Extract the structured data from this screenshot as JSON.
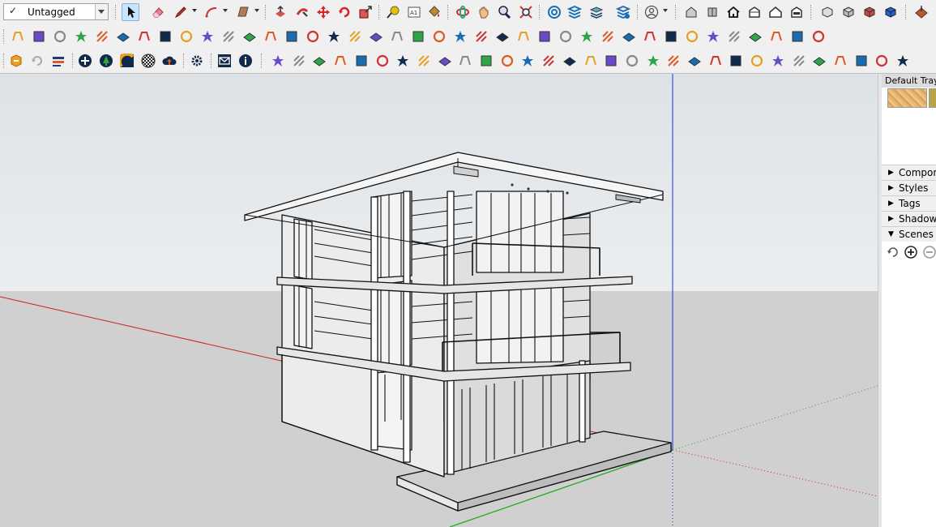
{
  "toolbar": {
    "tag_selector": {
      "check": "✓",
      "value": "Untagged"
    }
  },
  "tray": {
    "title": "Default Tray",
    "swatches": [
      {
        "color": "#e8b873"
      },
      {
        "color": "#b8a34a"
      }
    ],
    "panels": [
      {
        "label": "Components",
        "expanded": false
      },
      {
        "label": "Styles",
        "expanded": false
      },
      {
        "label": "Tags",
        "expanded": false
      },
      {
        "label": "Shadows",
        "expanded": false
      },
      {
        "label": "Scenes",
        "expanded": true
      }
    ],
    "scene_tools": [
      "refresh-scenes-icon",
      "add-scene-icon",
      "remove-scene-icon"
    ]
  },
  "viewport": {
    "sky_color": "#e4e8eb",
    "ground_color": "#d0d0d0",
    "axis_colors": {
      "red": "#cc2222",
      "green": "#22aa22",
      "blue": "#1f2fd8"
    },
    "model": "three-story-modern-house"
  }
}
